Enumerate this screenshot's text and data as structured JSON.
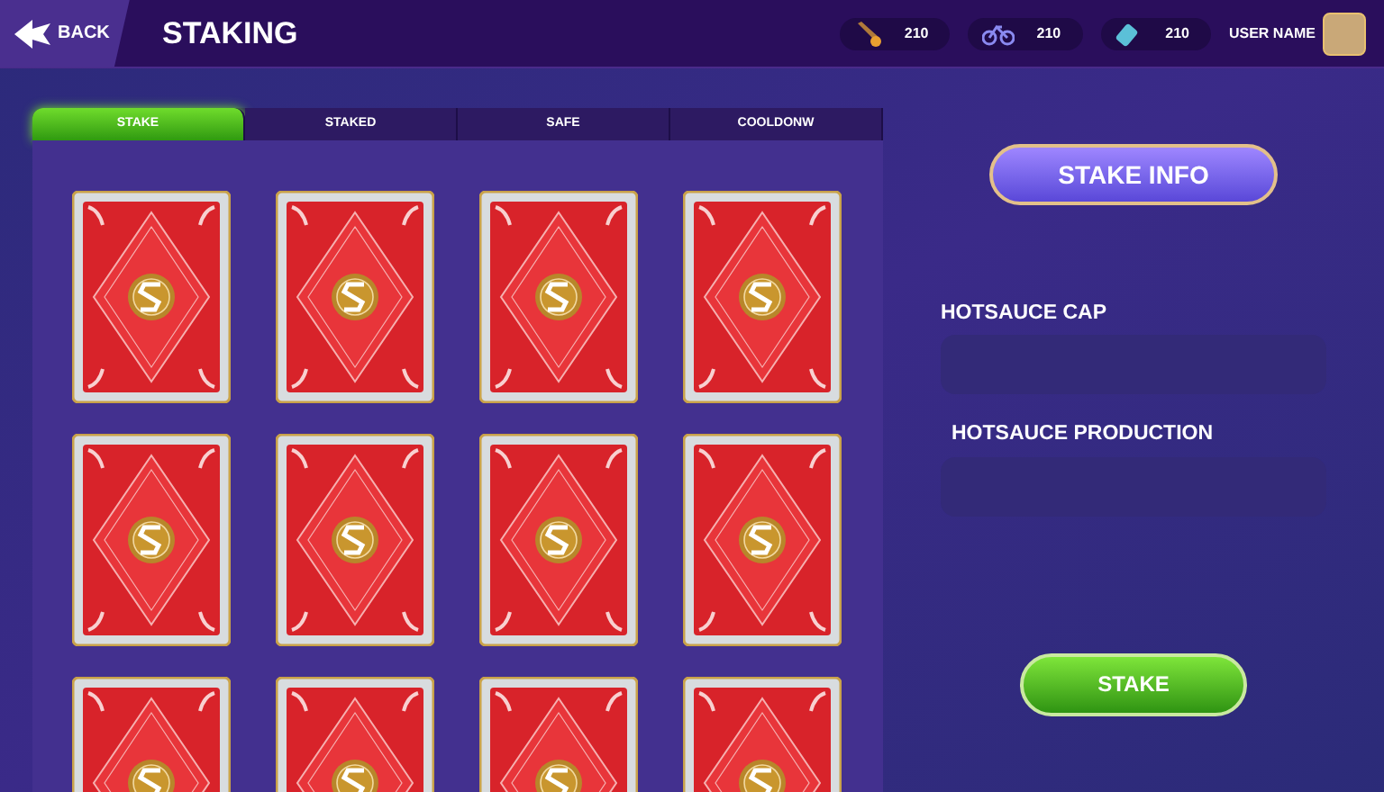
{
  "header": {
    "back_label": "BACK",
    "title": "STAKING",
    "resources": [
      {
        "kind": "torch",
        "amount": "210"
      },
      {
        "kind": "bike",
        "amount": "210"
      },
      {
        "kind": "bottle",
        "amount": "210"
      }
    ],
    "user_name": "USER NAME"
  },
  "tabs": [
    {
      "label": "STAKE",
      "selected": true
    },
    {
      "label": "STAKED",
      "selected": false
    },
    {
      "label": "SAFE",
      "selected": false
    },
    {
      "label": "COOLDONW",
      "selected": false
    }
  ],
  "cards": [
    {
      "kind": "card-back"
    },
    {
      "kind": "card-back"
    },
    {
      "kind": "card-back"
    },
    {
      "kind": "card-back"
    },
    {
      "kind": "card-back"
    },
    {
      "kind": "card-back"
    },
    {
      "kind": "card-back"
    },
    {
      "kind": "card-back"
    },
    {
      "kind": "card-back"
    },
    {
      "kind": "card-back"
    },
    {
      "kind": "card-back"
    },
    {
      "kind": "card-back"
    }
  ],
  "info": {
    "title": "STAKE INFO",
    "fields": [
      {
        "label": "HOTSAUCE CAP"
      },
      {
        "label": "HOTSAUCE PRODUCTION"
      }
    ],
    "button": "STAKE"
  }
}
